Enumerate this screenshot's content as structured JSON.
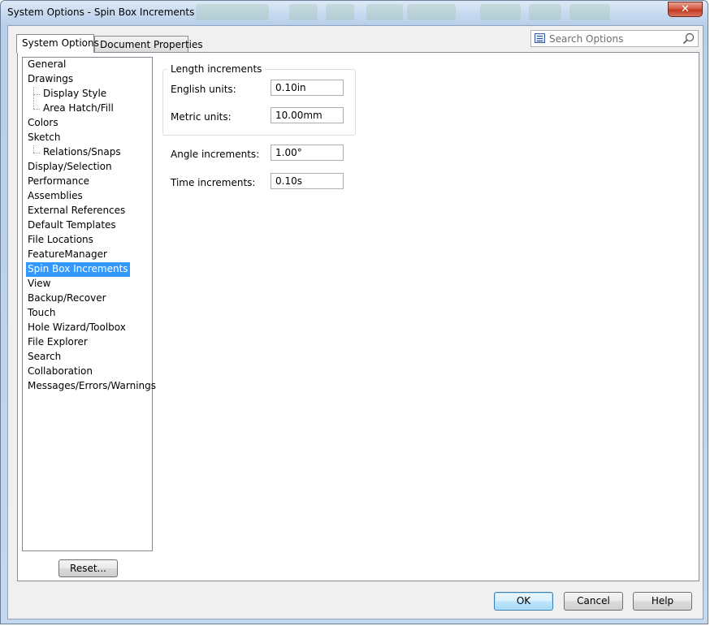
{
  "window": {
    "title": "System Options - Spin Box Increments",
    "close_glyph": "✕"
  },
  "tabs": [
    {
      "label": "System Options",
      "active": true
    },
    {
      "label": "Document Properties",
      "active": false
    }
  ],
  "search": {
    "placeholder": "Search Options",
    "left_icon": "options-list-icon",
    "right_icon": "magnifier-icon"
  },
  "tree": {
    "items": [
      {
        "label": "General",
        "level": 0
      },
      {
        "label": "Drawings",
        "level": 0
      },
      {
        "label": "Display Style",
        "level": 1
      },
      {
        "label": "Area Hatch/Fill",
        "level": 1
      },
      {
        "label": "Colors",
        "level": 0
      },
      {
        "label": "Sketch",
        "level": 0
      },
      {
        "label": "Relations/Snaps",
        "level": 1
      },
      {
        "label": "Display/Selection",
        "level": 0
      },
      {
        "label": "Performance",
        "level": 0
      },
      {
        "label": "Assemblies",
        "level": 0
      },
      {
        "label": "External References",
        "level": 0
      },
      {
        "label": "Default Templates",
        "level": 0
      },
      {
        "label": "File Locations",
        "level": 0
      },
      {
        "label": "FeatureManager",
        "level": 0
      },
      {
        "label": "Spin Box Increments",
        "level": 0,
        "selected": true
      },
      {
        "label": "View",
        "level": 0
      },
      {
        "label": "Backup/Recover",
        "level": 0
      },
      {
        "label": "Touch",
        "level": 0
      },
      {
        "label": "Hole Wizard/Toolbox",
        "level": 0
      },
      {
        "label": "File Explorer",
        "level": 0
      },
      {
        "label": "Search",
        "level": 0
      },
      {
        "label": "Collaboration",
        "level": 0
      },
      {
        "label": "Messages/Errors/Warnings",
        "level": 0
      }
    ]
  },
  "reset_label": "Reset...",
  "length_increments": {
    "title": "Length increments",
    "english_label": "English units:",
    "english_value": "0.10in",
    "metric_label": "Metric units:",
    "metric_value": "10.00mm"
  },
  "angle": {
    "label": "Angle increments:",
    "value": "1.00°"
  },
  "time": {
    "label": "Time increments:",
    "value": "0.10s"
  },
  "buttons": {
    "ok": "OK",
    "cancel": "Cancel",
    "help": "Help"
  },
  "colors": {
    "selection": "#3399ff",
    "close_button": "#c2381f",
    "title_bar": "#c5d8ef"
  }
}
